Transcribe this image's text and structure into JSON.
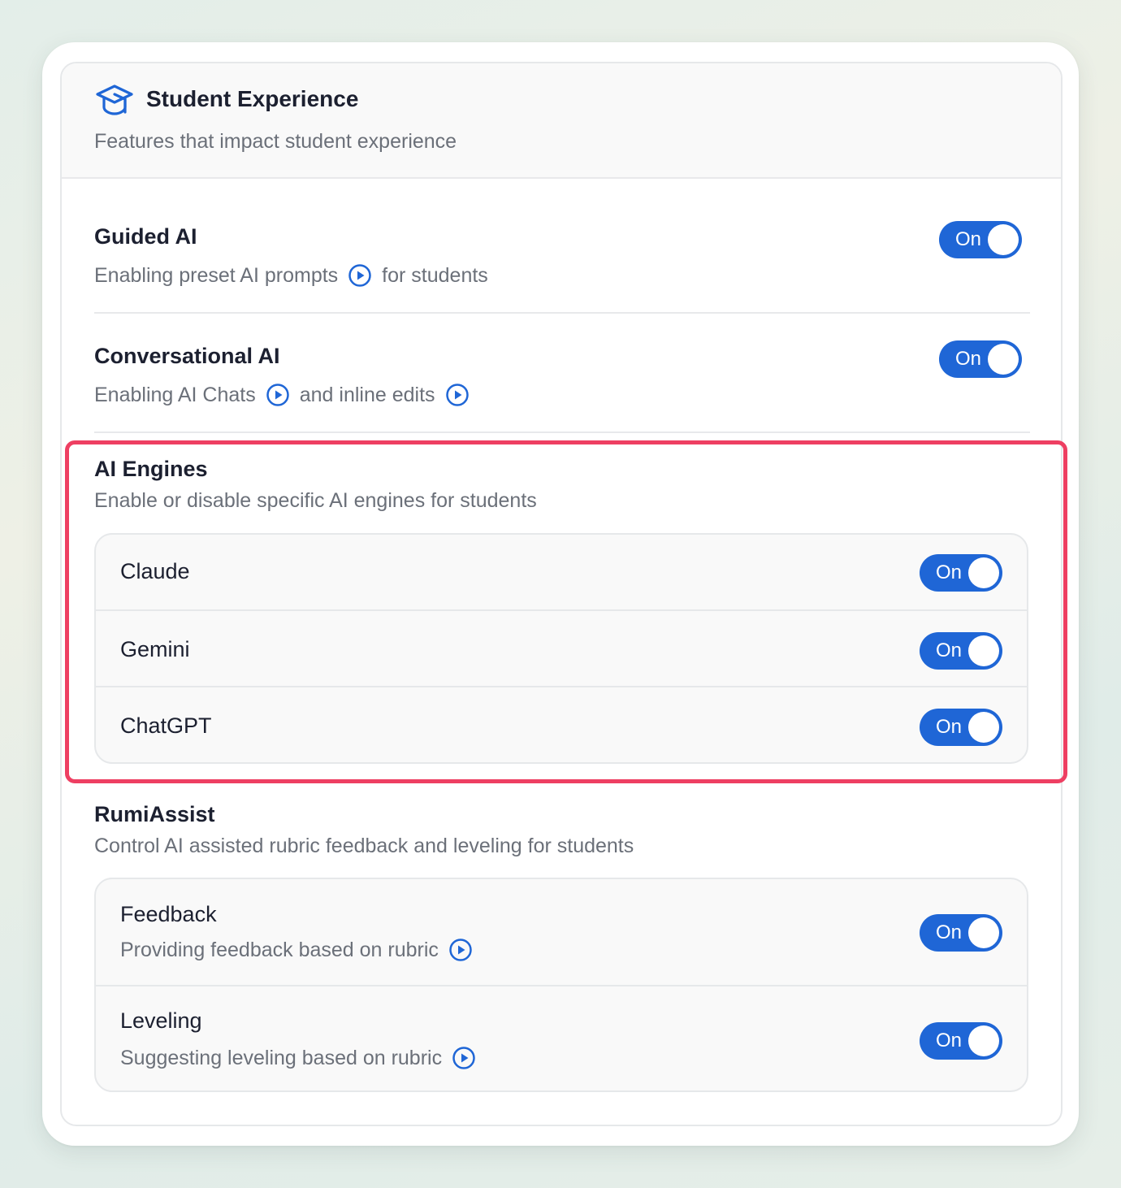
{
  "panel": {
    "title": "Student Experience",
    "subtitle": "Features that impact student experience",
    "icon": "graduation-cap-icon"
  },
  "guided_ai": {
    "title": "Guided AI",
    "desc_before": "Enabling preset AI prompts",
    "desc_after": "for students",
    "toggle_label": "On",
    "enabled": true
  },
  "conversational_ai": {
    "title": "Conversational AI",
    "desc_part1": "Enabling AI Chats",
    "desc_part2": "and inline edits",
    "toggle_label": "On",
    "enabled": true
  },
  "ai_engines": {
    "title": "AI Engines",
    "subtitle": "Enable or disable specific AI engines for students",
    "items": [
      {
        "label": "Claude",
        "toggle_label": "On",
        "enabled": true
      },
      {
        "label": "Gemini",
        "toggle_label": "On",
        "enabled": true
      },
      {
        "label": "ChatGPT",
        "toggle_label": "On",
        "enabled": true
      }
    ]
  },
  "rumi_assist": {
    "title": "RumiAssist",
    "subtitle": "Control AI assisted rubric feedback and leveling for students",
    "items": [
      {
        "label": "Feedback",
        "desc": "Providing feedback based on rubric",
        "toggle_label": "On",
        "enabled": true
      },
      {
        "label": "Leveling",
        "desc": "Suggesting leveling based on rubric",
        "toggle_label": "On",
        "enabled": true
      }
    ]
  },
  "colors": {
    "accent": "#1f66d6",
    "highlight": "#ee3f62",
    "text_primary": "#1c2030",
    "text_secondary": "#6b7079"
  }
}
